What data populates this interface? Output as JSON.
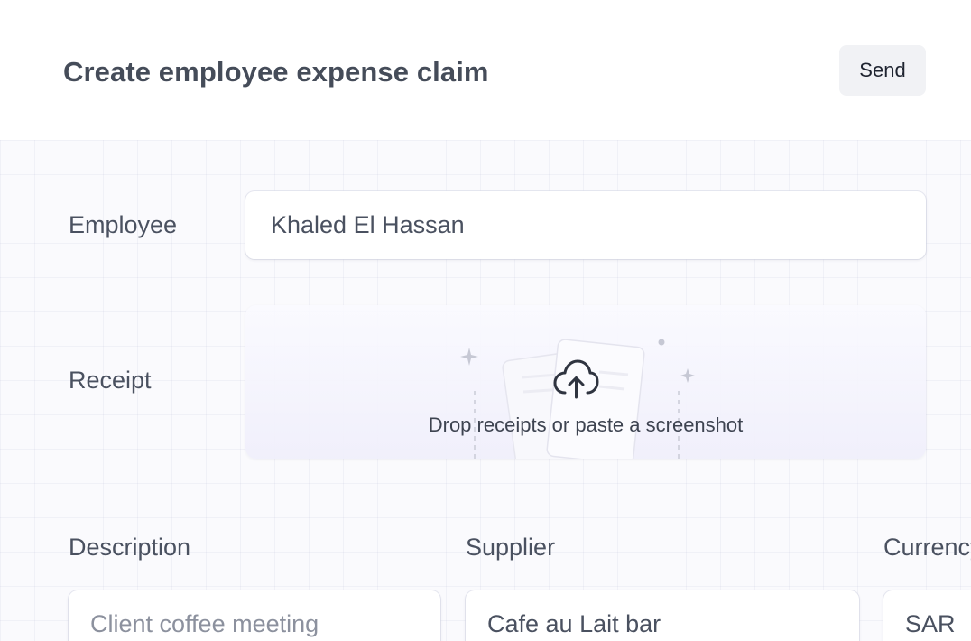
{
  "header": {
    "title": "Create employee expense claim",
    "send_label": "Send"
  },
  "form": {
    "employee": {
      "label": "Employee",
      "value": "Khaled El Hassan"
    },
    "receipt": {
      "label": "Receipt",
      "dropzone_text": "Drop receipts or paste a screenshot",
      "icon": "cloud-upload-icon"
    },
    "description": {
      "label": "Description",
      "placeholder": "Client coffee meeting"
    },
    "supplier": {
      "label": "Supplier",
      "value": "Cafe au Lait bar"
    },
    "currency": {
      "label": "Currency",
      "value": "SAR"
    }
  },
  "colors": {
    "title_text": "#454c59",
    "label_text": "#4a5160",
    "button_bg": "#f1f2f5",
    "form_bg": "#fafafd"
  }
}
